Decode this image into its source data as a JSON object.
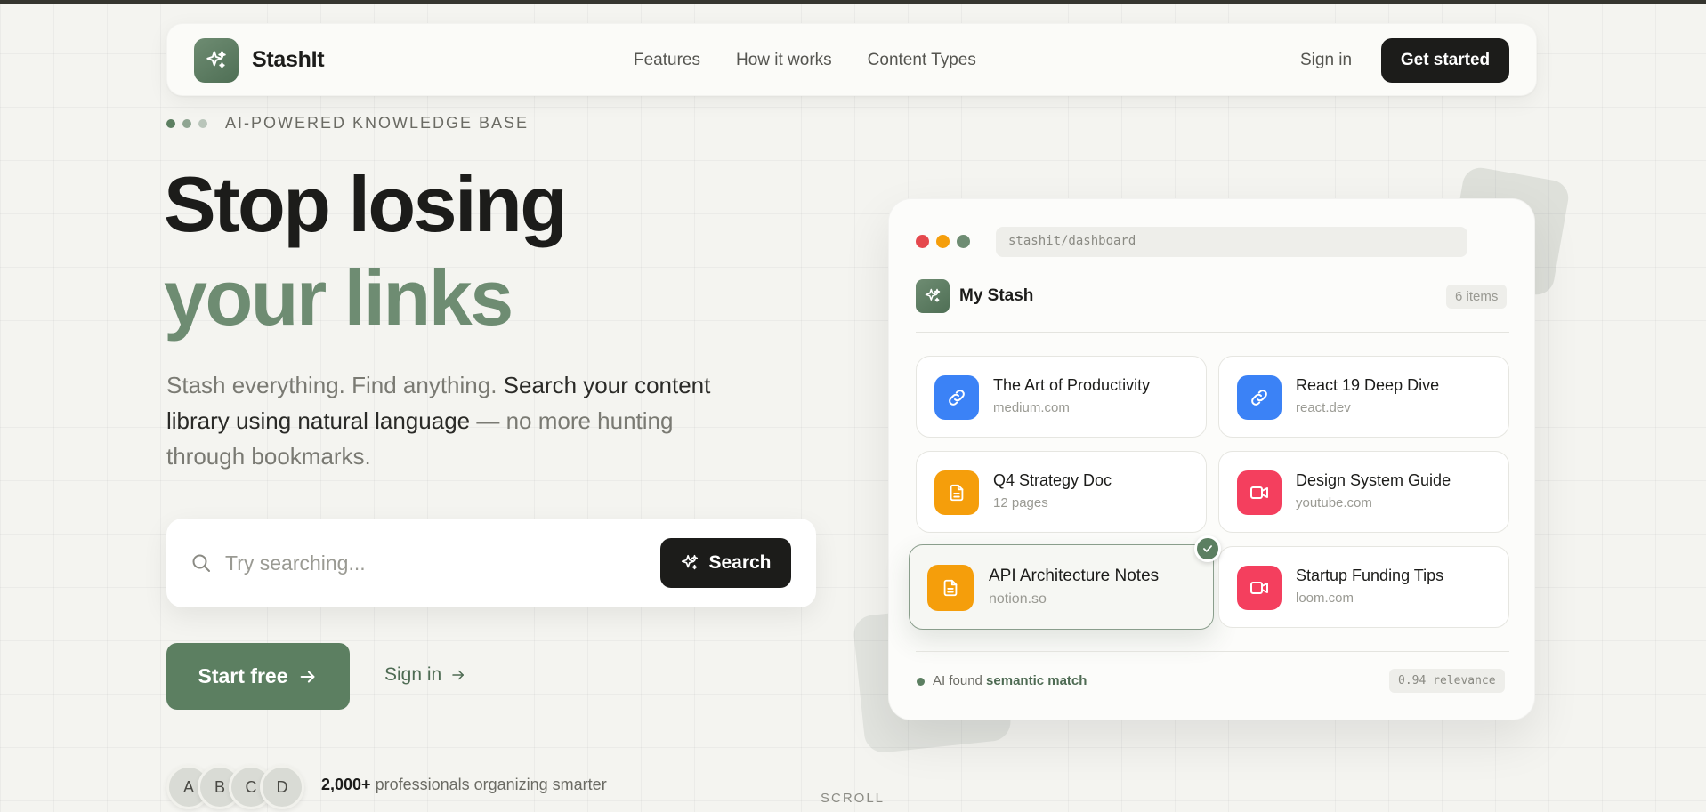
{
  "nav": {
    "brand": "StashIt",
    "links": [
      "Features",
      "How it works",
      "Content Types"
    ],
    "signin": "Sign in",
    "cta": "Get started"
  },
  "hero": {
    "eyebrow": "AI-POWERED KNOWLEDGE BASE",
    "title_line1": "Stop losing",
    "title_line2": "your links",
    "lede_part1": "Stash everything. Find anything. ",
    "lede_bold": "Search your content library using natural language",
    "lede_part2": " — no more hunting through bookmarks.",
    "search_placeholder": "Try searching...",
    "search_button": "Search",
    "start_button": "Start free",
    "signin_link": "Sign in",
    "avatars": [
      "A",
      "B",
      "C",
      "D"
    ],
    "social_bold": "2,000+",
    "social_rest": " professionals organizing smarter",
    "scroll": "SCROLL"
  },
  "dashboard": {
    "url": "stashit/dashboard",
    "title": "My Stash",
    "count": "6 items",
    "cards": [
      {
        "title": "The Art of Productivity",
        "sub": "medium.com",
        "icon": "link-icon",
        "color": "#3b82f6"
      },
      {
        "title": "React 19 Deep Dive",
        "sub": "react.dev",
        "icon": "link-icon",
        "color": "#3b82f6"
      },
      {
        "title": "Q4 Strategy Doc",
        "sub": "12 pages",
        "icon": "document-icon",
        "color": "#f59e0b"
      },
      {
        "title": "Design System Guide",
        "sub": "youtube.com",
        "icon": "video-icon",
        "color": "#f43f5e"
      },
      {
        "title": "API Architecture Notes",
        "sub": "notion.so",
        "icon": "document-icon",
        "color": "#f59e0b"
      },
      {
        "title": "Startup Funding Tips",
        "sub": "loom.com",
        "icon": "video-icon",
        "color": "#f43f5e"
      }
    ],
    "ai_prefix": "AI found ",
    "ai_bold": "semantic match",
    "relevance": "0.94 relevance"
  },
  "colors": {
    "accent": "#5c7f61",
    "accent_light": "#6e8c72",
    "dark": "#1c1c1a"
  }
}
